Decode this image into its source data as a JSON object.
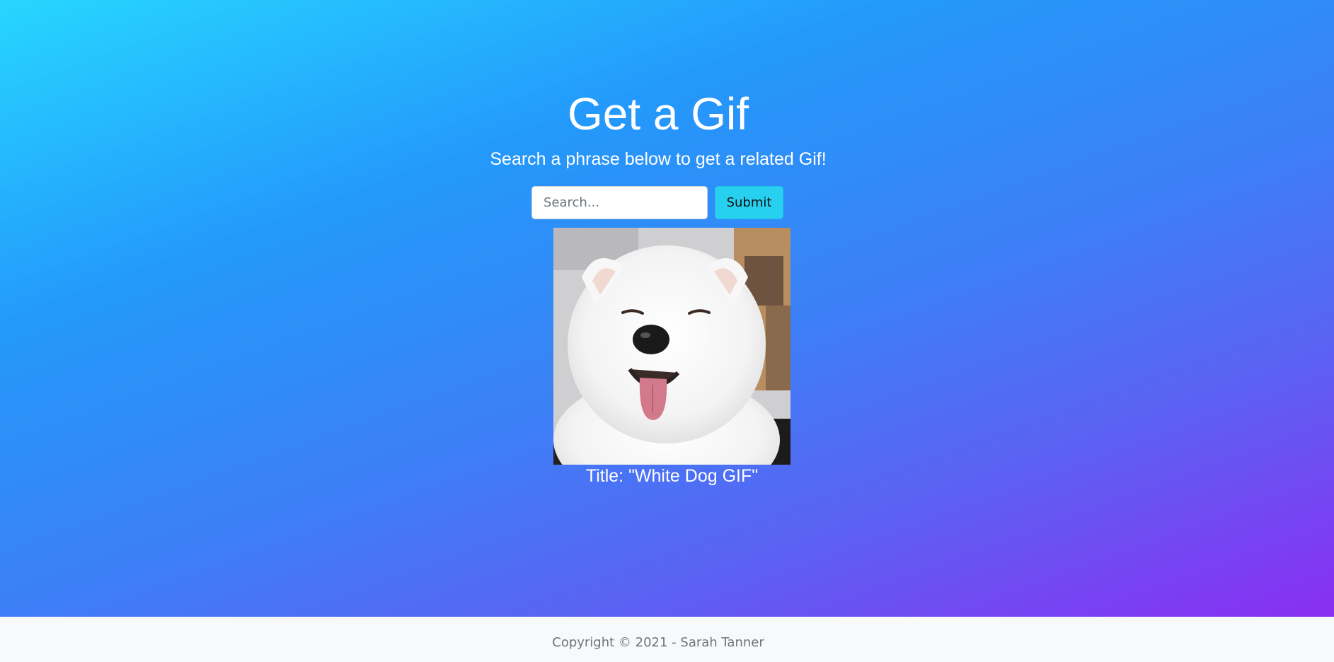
{
  "header": {
    "title": "Get a Gif",
    "subtitle": "Search a phrase below to get a related Gif!"
  },
  "search": {
    "value": "",
    "placeholder": "Search...",
    "submit_label": "Submit"
  },
  "result": {
    "image_icon": "white-dog-photo",
    "caption": "Title: \"White Dog GIF\""
  },
  "footer": {
    "copyright": "Copyright © 2021 - Sarah Tanner"
  },
  "colors": {
    "gradient_start": "#27d6ff",
    "gradient_mid": "#2399fb",
    "gradient_end": "#8a2ef1",
    "submit_bg": "#28d0f0",
    "footer_bg": "#f8f9fa"
  }
}
